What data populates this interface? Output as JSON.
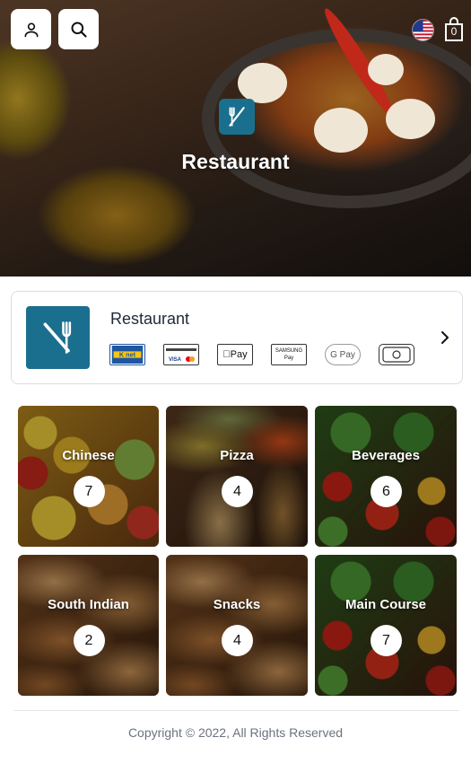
{
  "header": {
    "account_icon": "user-icon",
    "search_icon": "search-icon",
    "language_flag": "us-flag-icon",
    "cart_icon": "shopping-bag-icon",
    "cart_count": "0"
  },
  "hero": {
    "logo_icon": "fork-knife-icon",
    "title": "Restaurant"
  },
  "store": {
    "name": "Restaurant",
    "logo_icon": "fork-knife-icon",
    "payment_methods": [
      {
        "name": "knet-icon",
        "label": "K net"
      },
      {
        "name": "visa-mastercard-icon",
        "label": "VISA"
      },
      {
        "name": "apple-pay-icon",
        "label": "Pay"
      },
      {
        "name": "samsung-pay-icon",
        "label": "SAMSUNG Pay"
      },
      {
        "name": "google-pay-icon",
        "label": "G Pay"
      },
      {
        "name": "cash-icon",
        "label": ""
      }
    ],
    "chevron_icon": "chevron-right-icon"
  },
  "categories": [
    {
      "name": "Chinese",
      "count": "7"
    },
    {
      "name": "Pizza",
      "count": "4"
    },
    {
      "name": "Beverages",
      "count": "6"
    },
    {
      "name": "South Indian",
      "count": "2"
    },
    {
      "name": "Snacks",
      "count": "4"
    },
    {
      "name": "Main Course",
      "count": "7"
    }
  ],
  "footer": {
    "copyright": "Copyright © 2022, All Rights Reserved"
  },
  "colors": {
    "brand": "#1b6f8e",
    "text_dark": "#1f2937",
    "text_muted": "#6b7280",
    "border": "#d9dde2"
  }
}
